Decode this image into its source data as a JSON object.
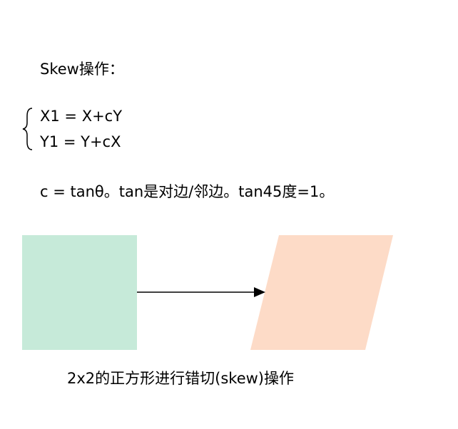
{
  "title": "Skew操作：",
  "equations": [
    "X1 = X+cY",
    "Y1 = Y+cX"
  ],
  "formula": "c = tanθ。tan是对边/邻边。tan45度=1。",
  "caption": "2x2的正方形进行错切(skew)操作",
  "colors": {
    "square": "#c6ead9",
    "parallelogram": "#fddbc7",
    "arrow": "#000000"
  }
}
